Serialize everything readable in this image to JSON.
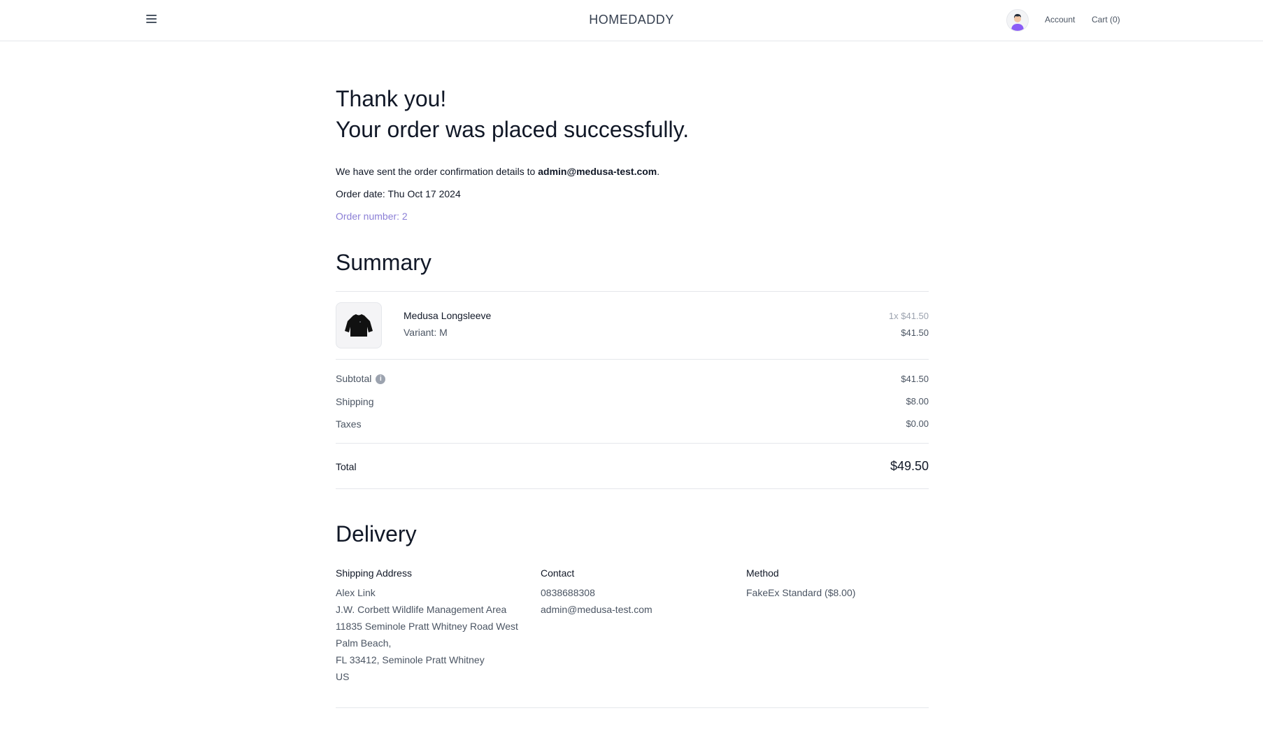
{
  "header": {
    "brand": "HOMEDADDY",
    "account_label": "Account",
    "cart_label": "Cart (0)",
    "icons": [
      "menu-icon",
      "avatar"
    ]
  },
  "confirmation": {
    "thank_you": "Thank you!",
    "success": "Your order was placed successfully.",
    "sent_prefix": "We have sent the order confirmation details to",
    "email": "admin@medusa-test.com",
    "sent_suffix": ".",
    "order_date": "Order date: Thu Oct 17 2024",
    "order_number": "Order number: 2"
  },
  "summary": {
    "title": "Summary",
    "item": {
      "name": "Medusa Longsleeve",
      "variant": "Variant: M",
      "quantity_price": "1x $41.50",
      "line_total": "$41.50"
    },
    "rows": [
      {
        "label": "Subtotal",
        "value": "$41.50"
      },
      {
        "label": "Shipping",
        "value": "$8.00"
      },
      {
        "label": "Taxes",
        "value": "$0.00"
      }
    ],
    "total_label": "Total",
    "total_value": "$49.50"
  },
  "delivery": {
    "title": "Delivery",
    "shipping_address": {
      "title": "Shipping Address",
      "lines": [
        "Alex Link",
        "J.W. Corbett Wildlife Management Area",
        "11835 Seminole Pratt Whitney Road West",
        "Palm Beach,",
        "FL 33412, Seminole Pratt Whitney",
        "US"
      ]
    },
    "contact": {
      "title": "Contact",
      "lines": [
        "0838688308",
        "admin@medusa-test.com"
      ]
    },
    "method": {
      "title": "Method",
      "lines": [
        "FakeEx Standard ($8.00)"
      ]
    }
  },
  "colors": {
    "accent": "#8b7fd6",
    "text": "#111827",
    "muted": "#4b5563",
    "divider": "#e5e7eb"
  }
}
